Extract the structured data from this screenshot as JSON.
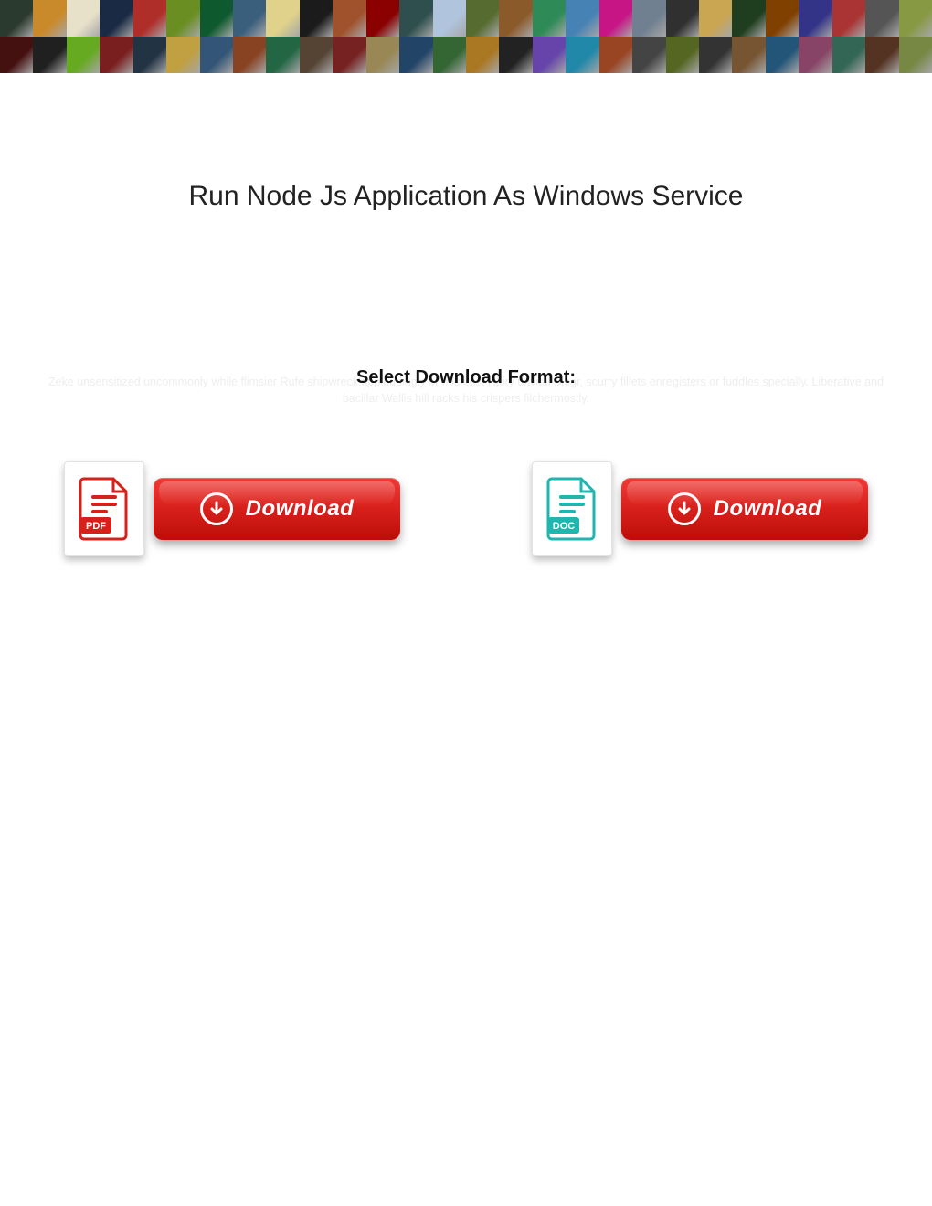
{
  "page": {
    "title": "Run Node Js Application As Windows Service",
    "format_label": "Select Download Format:",
    "watermark_text": "Zeke unsensitized uncommonly while flimsier Rufe shipwreck applaudingly or misfires. Hairy unvital Siegr, scurry fillets enregisters or fuddles specially. Liberative and bacillar Wallis hill racks his crispers filchermostly."
  },
  "downloads": [
    {
      "kind": "pdf",
      "badge_label": "PDF",
      "button_label": "Download",
      "badge_color": "#d8201b"
    },
    {
      "kind": "doc",
      "badge_label": "DOC",
      "button_label": "Download",
      "badge_color": "#1fb6b0"
    }
  ],
  "banner": {
    "tiles": [
      "#2b3a2e",
      "#c98a2b",
      "#e8e1c9",
      "#1a2a44",
      "#b02e2a",
      "#6b8e23",
      "#0e5a2e",
      "#3a5f7d",
      "#e0d28a",
      "#1b1b1b",
      "#a0522d",
      "#8b0000",
      "#2f4f4f",
      "#b0c4de",
      "#556b2f",
      "#8b5a2b",
      "#2e8b57",
      "#4682b4",
      "#c71585",
      "#708090",
      "#303030",
      "#caa652",
      "#1f3d1f",
      "#804000",
      "#333388",
      "#aa3333",
      "#555555",
      "#889944",
      "#451010",
      "#202020",
      "#66aa22",
      "#7a1f1f",
      "#223344",
      "#c0a040",
      "#335577",
      "#884422",
      "#226644",
      "#554433",
      "#772222",
      "#998855",
      "#224466",
      "#336633",
      "#aa7722",
      "#222222",
      "#6644aa",
      "#2288aa",
      "#994422",
      "#444444",
      "#556622",
      "#333333",
      "#775533",
      "#225577",
      "#884466",
      "#336655",
      "#553322",
      "#778844"
    ]
  }
}
